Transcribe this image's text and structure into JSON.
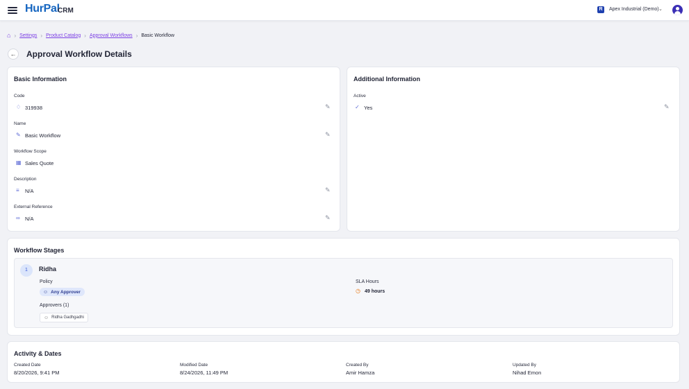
{
  "app": {
    "brand": "HurPal",
    "brand_suffix": "CRM"
  },
  "header": {
    "org_name": "Apex Industrial (Demo)",
    "org_initial": "R"
  },
  "breadcrumb": {
    "items": [
      "Settings",
      "Product Catalog",
      "Approval Workflows"
    ],
    "current": "Basic Workflow"
  },
  "page": {
    "title": "Approval Workflow Details"
  },
  "basic_info": {
    "title": "Basic Information",
    "fields": [
      {
        "label": "Code",
        "value": "319938",
        "icon": "tag-icon"
      },
      {
        "label": "Name",
        "value": "Basic Workflow",
        "icon": "pencil-icon"
      },
      {
        "label": "Workflow Scope",
        "value": "Sales Quote",
        "icon": "grid-icon"
      },
      {
        "label": "Description",
        "value": "N/A",
        "icon": "lines-icon"
      },
      {
        "label": "External Reference",
        "value": "N/A",
        "icon": "link-icon"
      }
    ]
  },
  "additional_info": {
    "title": "Additional Information",
    "active_label": "Active",
    "active_value": "Yes"
  },
  "workflow_stages": {
    "title": "Workflow Stages",
    "stages": [
      {
        "number": "1",
        "name": "Ridha",
        "policy_label": "Policy",
        "policy_value": "Any Approver",
        "sla_label": "SLA Hours",
        "sla_value": "49 hours",
        "approvers_label": "Approvers (1)",
        "approvers": [
          "Ridha Gadhgadhi"
        ]
      }
    ]
  },
  "activity": {
    "title": "Activity & Dates",
    "created_date_label": "Created Date",
    "created_date": "8/20/2026, 9:41 PM",
    "modified_date_label": "Modified Date",
    "modified_date": "8/24/2026, 11:49 PM",
    "created_by_label": "Created By",
    "created_by": "Amir Hamza",
    "updated_by_label": "Updated By",
    "updated_by": "Nihad Emon"
  },
  "colors": {
    "brand": "#1565c0",
    "accent": "#7b3fe4",
    "sla": "#e8730c"
  }
}
